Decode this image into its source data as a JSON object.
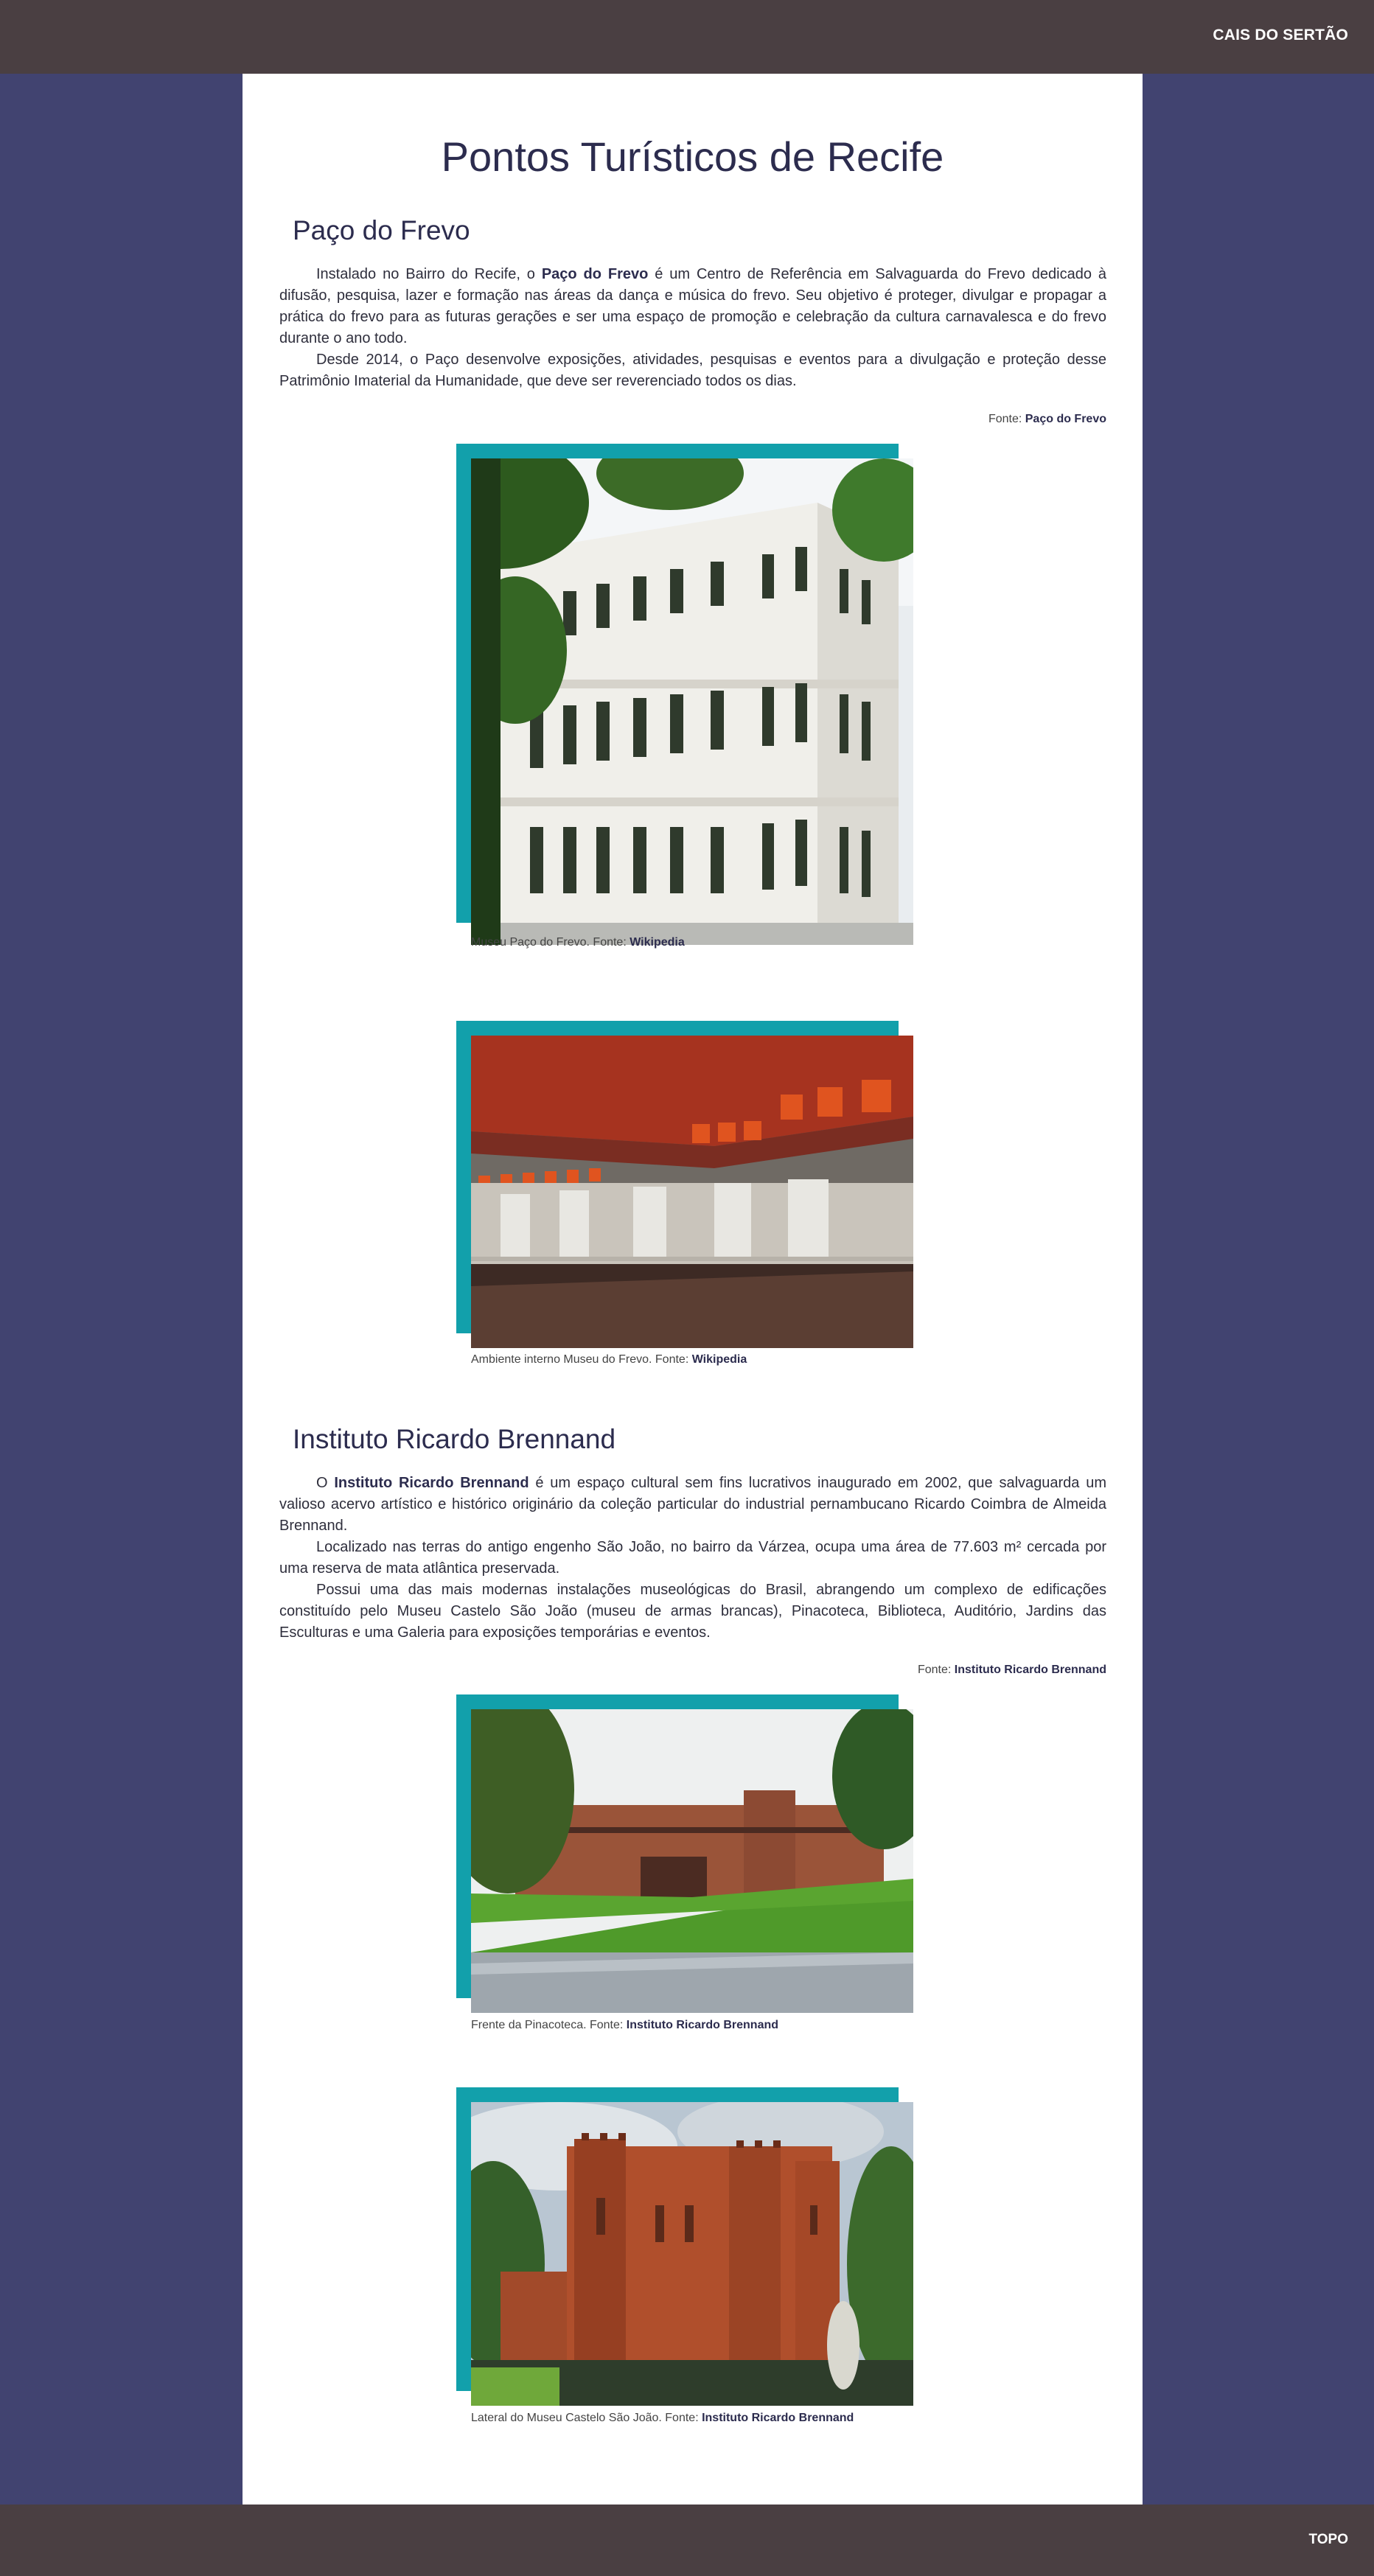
{
  "header": {
    "nav_label": "CAIS DO SERTÃO"
  },
  "footer": {
    "nav_label": "TOPO"
  },
  "page": {
    "title": "Pontos Turísticos de Recife"
  },
  "sections": [
    {
      "title": "Paço do Frevo",
      "paragraphs": [
        {
          "before": "Instalado no Bairro do Recife, o ",
          "link": "Paço do Frevo",
          "after": " é um Centro de Referência em Salvaguarda do Frevo dedicado à difusão, pesquisa, lazer e formação nas áreas da dança e música do frevo. Seu objetivo é proteger, divulgar e propagar a prática do frevo para as futuras gerações e ser uma espaço de promoção e celebração da cultura carnavalesca e do frevo durante o ano todo."
        },
        {
          "text": "Desde 2014, o Paço desenvolve exposições, atividades, pesquisas e eventos para a divulgação e proteção desse Patrimônio Imaterial da Humanidade, que deve ser reverenciado todos os dias."
        }
      ],
      "source": {
        "label": "Fonte: ",
        "link": "Paço do Frevo"
      },
      "figures": [
        {
          "caption": "Museu Paço do Frevo. Fonte: ",
          "link": "Wikipedia"
        },
        {
          "caption": "Ambiente interno Museu do Frevo. Fonte: ",
          "link": "Wikipedia"
        }
      ]
    },
    {
      "title": "Instituto Ricardo Brennand",
      "paragraphs": [
        {
          "before": "O ",
          "link": "Instituto Ricardo Brennand",
          "after": " é um espaço cultural sem fins lucrativos inaugurado em 2002, que salvaguarda um valioso acervo artístico e histórico originário da coleção particular do industrial pernambucano Ricardo Coimbra de Almeida Brennand."
        },
        {
          "text": "Localizado nas terras do antigo engenho São João, no bairro da Várzea, ocupa uma área de 77.603 m² cercada por uma reserva de mata atlântica preservada."
        },
        {
          "text": "Possui uma das mais modernas instalações museológicas do Brasil, abrangendo um complexo de edificações constituído pelo Museu Castelo São João (museu de armas brancas), Pinacoteca, Biblioteca, Auditório, Jardins das Esculturas e uma Galeria para exposições temporárias e eventos."
        }
      ],
      "source": {
        "label": "Fonte: ",
        "link": "Instituto Ricardo Brennand"
      },
      "figures": [
        {
          "caption": "Frente da Pinacoteca. Fonte: ",
          "link": "Instituto Ricardo Brennand"
        },
        {
          "caption": "Lateral do Museu Castelo São João. Fonte: ",
          "link": "Instituto Ricardo Brennand"
        }
      ]
    }
  ],
  "colors": {
    "topbar": "#4a3f42",
    "background": "#414370",
    "accent": "#12a0ab",
    "link": "#2c2c4e"
  }
}
